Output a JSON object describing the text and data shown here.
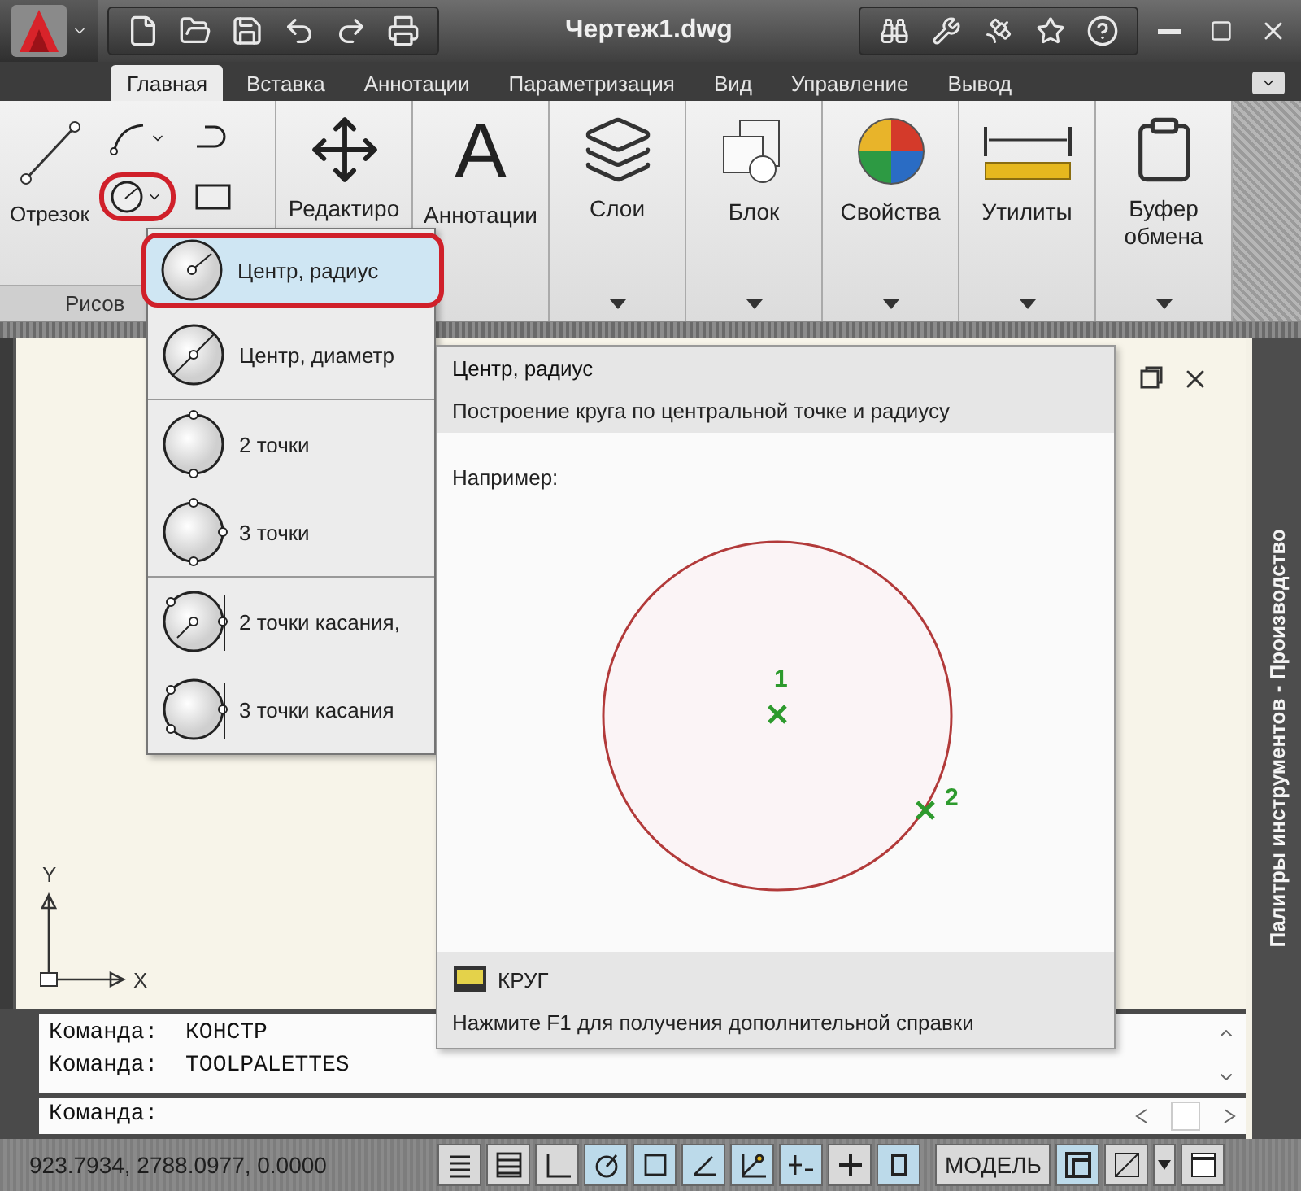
{
  "title_bar": {
    "title": "Чертеж1.dwg"
  },
  "ribbon_tabs": [
    {
      "label": "Главная",
      "selected": true
    },
    {
      "label": "Вставка",
      "selected": false
    },
    {
      "label": "Аннотации",
      "selected": false
    },
    {
      "label": "Параметризация",
      "selected": false
    },
    {
      "label": "Вид",
      "selected": false
    },
    {
      "label": "Управление",
      "selected": false
    },
    {
      "label": "Вывод",
      "selected": false
    }
  ],
  "draw_panel": {
    "title": "Рисов",
    "line_label": "Отрезок",
    "circle_highlighted": true
  },
  "panels": [
    {
      "kind": "modify",
      "label": "Редактиро"
    },
    {
      "kind": "annotate",
      "glyph": "A",
      "label": "Аннотации",
      "has_menu": false
    },
    {
      "kind": "layers",
      "label": "Слои",
      "has_menu": true
    },
    {
      "kind": "block",
      "label": "Блок",
      "has_menu": true
    },
    {
      "kind": "properties",
      "label": "Свойства",
      "has_menu": true
    },
    {
      "kind": "utilities",
      "label": "Утилиты",
      "has_menu": true
    },
    {
      "kind": "clipboard",
      "label": "Буфер обмена",
      "has_menu": true
    }
  ],
  "circle_menu": [
    {
      "items": [
        {
          "kind": "center-radius",
          "label": "Центр, радиус",
          "selected": true
        },
        {
          "kind": "center-diameter",
          "label": "Центр, диаметр",
          "selected": false
        }
      ]
    },
    {
      "items": [
        {
          "kind": "two-point",
          "label": "2 точки",
          "selected": false
        },
        {
          "kind": "three-point",
          "label": "3 точки",
          "selected": false
        }
      ]
    },
    {
      "items": [
        {
          "kind": "tan-tan-radius",
          "label": "2 точки касания,",
          "selected": false
        },
        {
          "kind": "tan-tan-tan",
          "label": "3 точки касания",
          "selected": false
        }
      ]
    }
  ],
  "tooltip": {
    "title": "Центр, радиус",
    "description": "Построение круга по центральной точке и радиусу",
    "example_label": "Например:",
    "point_labels": [
      "1",
      "2"
    ],
    "command": "КРУГ",
    "help": "Нажмите F1 для получения дополнительной справки"
  },
  "canvas": {
    "ucs_y": "Y",
    "ucs_x": "X"
  },
  "palette": {
    "title": "Палитры инструментов - Производство"
  },
  "command_line": {
    "history": [
      "Команда:  КОНСТР",
      "Команда:  TOOLPALETTES"
    ],
    "prompt": "Команда:"
  },
  "status_bar": {
    "coordinates": "923.7934, 2788.0977, 0.0000",
    "toggles": [
      {
        "kind": "infer",
        "on": false
      },
      {
        "kind": "grid",
        "on": false
      },
      {
        "kind": "ortho",
        "on": false
      },
      {
        "kind": "polar",
        "on": true
      },
      {
        "kind": "osnap",
        "on": true
      },
      {
        "kind": "otrack",
        "on": true
      },
      {
        "kind": "ducs",
        "on": true
      },
      {
        "kind": "dyn",
        "on": true
      },
      {
        "kind": "lineweight",
        "on": false
      },
      {
        "kind": "qp",
        "on": true
      }
    ],
    "space": "МОДЕЛЬ"
  }
}
